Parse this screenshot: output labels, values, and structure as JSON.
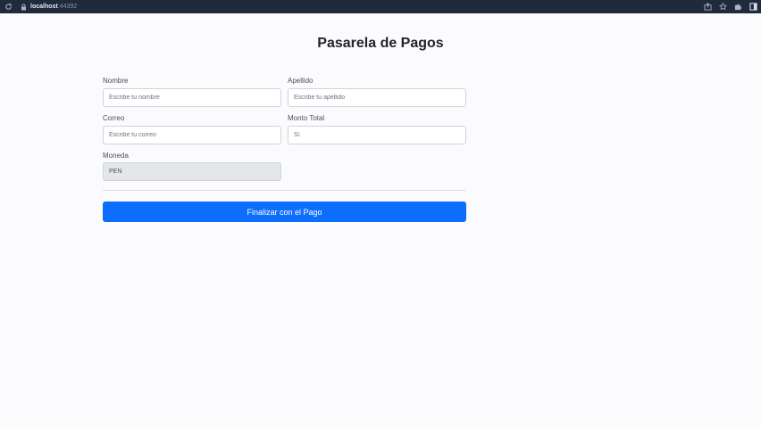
{
  "browser": {
    "url_host": "localhost",
    "url_port": ":44392",
    "icons": [
      "reload-icon",
      "lock-icon",
      "share-icon",
      "star-icon",
      "extensions-icon",
      "sidebar-icon"
    ]
  },
  "page": {
    "title": "Pasarela de Pagos"
  },
  "form": {
    "nombre": {
      "label": "Nombre",
      "placeholder": "Escribe tu nombre",
      "value": ""
    },
    "apellido": {
      "label": "Apellido",
      "placeholder": "Escribe tu apellido",
      "value": ""
    },
    "correo": {
      "label": "Correo",
      "placeholder": "Escribe tu correo",
      "value": ""
    },
    "monto": {
      "label": "Monto Total",
      "placeholder": "S/.",
      "value": ""
    },
    "moneda": {
      "label": "Moneda",
      "value": "PEN"
    },
    "submit_label": "Finalizar con el Pago"
  },
  "colors": {
    "primary": "#0d6efd",
    "chrome_bg": "#1f2a3c",
    "page_bg": "#fbfbfd"
  }
}
